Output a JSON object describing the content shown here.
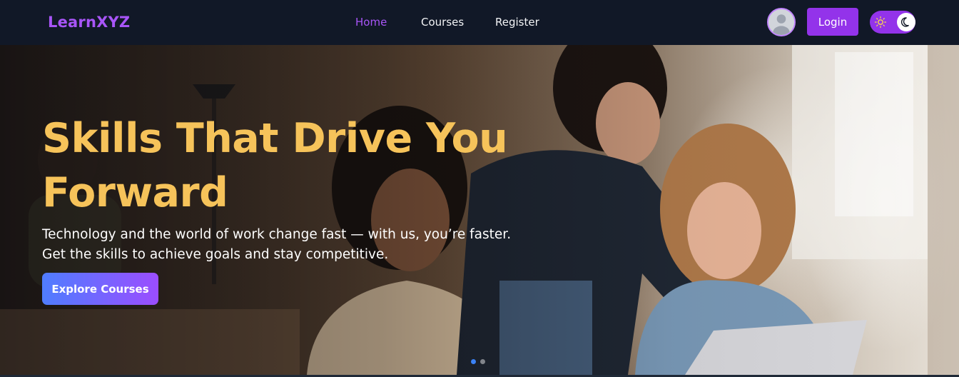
{
  "navbar": {
    "logo": "LearnXYZ",
    "links": [
      {
        "label": "Home",
        "active": true
      },
      {
        "label": "Courses",
        "active": false
      },
      {
        "label": "Register",
        "active": false
      }
    ],
    "avatar_icon": "user-avatar-icon",
    "login_label": "Login",
    "theme_toggle": {
      "sun_icon": "sun-icon",
      "moon_icon": "moon-icon",
      "mode": "dark"
    }
  },
  "hero": {
    "title": "Skills That Drive You Forward",
    "subtitle": "Technology and the world of work change fast — with us, you’re faster. Get the skills to achieve goals and stay competitive.",
    "cta_label": "Explore Courses",
    "carousel": {
      "slides": 2,
      "active_index": 0
    }
  },
  "colors": {
    "nav_bg": "#111827",
    "accent": "#9333ea",
    "logo": "#a855f7",
    "hero_title": "#f6c35a",
    "cta_gradient_start": "#4f7dff",
    "cta_gradient_end": "#9b4dff",
    "active_dot": "#3b82f6"
  }
}
